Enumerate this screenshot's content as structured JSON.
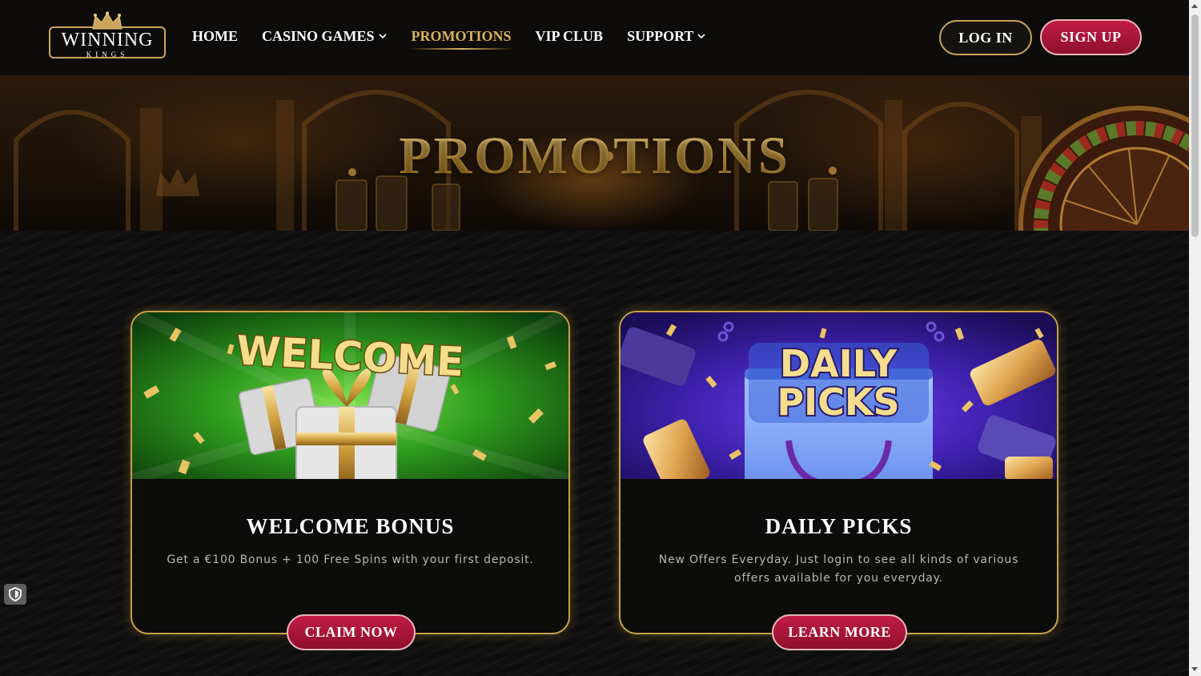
{
  "header": {
    "logo": {
      "main": "WINNING",
      "sub": "KINGS"
    },
    "nav": [
      {
        "label": "HOME",
        "dropdown": false,
        "active": false
      },
      {
        "label": "CASINO GAMES",
        "dropdown": true,
        "active": false
      },
      {
        "label": "PROMOTIONS",
        "dropdown": false,
        "active": true
      },
      {
        "label": "VIP CLUB",
        "dropdown": false,
        "active": false
      },
      {
        "label": "SUPPORT",
        "dropdown": true,
        "active": false
      }
    ],
    "login_label": "LOG IN",
    "signup_label": "SIGN UP"
  },
  "banner": {
    "title": "PROMOTIONS"
  },
  "promotions": [
    {
      "image_text": "WELCOME",
      "title": "WELCOME BONUS",
      "description": "Get a €100 Bonus + 100 Free Spins with your first deposit.",
      "button_label": "CLAIM NOW"
    },
    {
      "image_text_line1": "DAILY",
      "image_text_line2": "PICKS",
      "title": "DAILY PICKS",
      "description": "New Offers Everyday. Just login to see all kinds of various offers available for you everyday.",
      "button_label": "LEARN MORE"
    }
  ],
  "colors": {
    "gold": "#c9a045",
    "accent_red": "#b01a3e",
    "active_nav": "#d8b35d",
    "page_bg": "#111010"
  },
  "icons": [
    "crown-icon",
    "chevron-down-icon",
    "shield-icon"
  ]
}
